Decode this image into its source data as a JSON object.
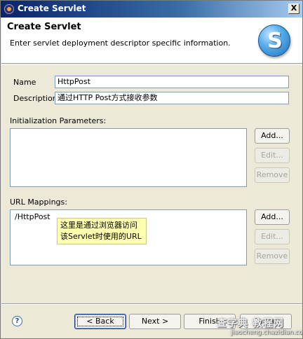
{
  "window": {
    "title": "Create Servlet",
    "close_label": "X"
  },
  "banner": {
    "heading": "Create Servlet",
    "description": "Enter servlet deployment descriptor specific information.",
    "logo_letter": "S"
  },
  "form": {
    "name_label": "Name",
    "name_value": "HttpPost",
    "description_label": "Description",
    "description_value": "通过HTTP Post方式接收参数"
  },
  "init_params": {
    "label": "Initialization Parameters:",
    "add": "Add...",
    "edit": "Edit...",
    "remove": "Remove"
  },
  "url_mappings": {
    "label": "URL Mappings:",
    "items": [
      "/HttpPost"
    ],
    "add": "Add...",
    "edit": "Edit...",
    "remove": "Remove",
    "tooltip_line1": "这里是通过浏览器访问",
    "tooltip_line2": "该Servlet时使用的URL"
  },
  "footer": {
    "back": "< Back",
    "next": "Next >",
    "finish": "Finish",
    "cancel": "Cancel"
  },
  "watermark": {
    "main": "查字典 教程网",
    "sub": "jiaocheng.chazidian.com"
  },
  "colors": {
    "titlebar": "#0a246a",
    "tooltip": "#ffffb0",
    "logo": "#1f6fb8"
  }
}
